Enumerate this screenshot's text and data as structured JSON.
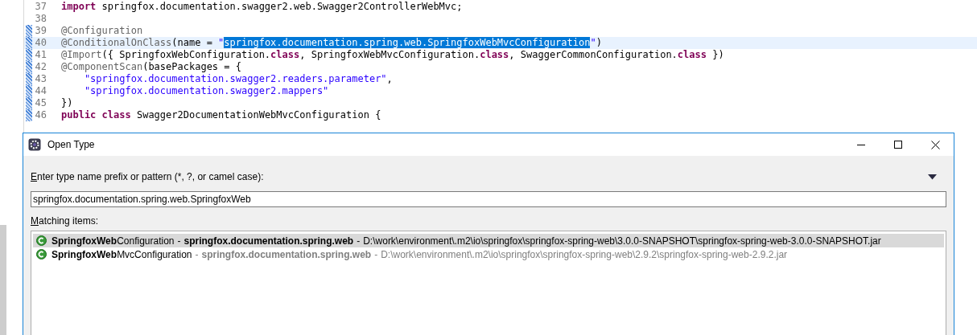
{
  "editor": {
    "lines": [
      {
        "number": "37",
        "current": false,
        "changed": false,
        "tokens": [
          {
            "kind": "keyword",
            "text": "import"
          },
          {
            "kind": "plain",
            "text": " springfox.documentation.swagger2.web.Swagger2ControllerWebMvc;"
          }
        ]
      },
      {
        "number": "38",
        "current": false,
        "changed": false
      },
      {
        "number": "39",
        "current": false,
        "changed": true,
        "tokens": [
          {
            "kind": "annotation",
            "text": "@Configuration"
          }
        ]
      },
      {
        "number": "40",
        "current": true,
        "changed": true,
        "tokens": [
          {
            "kind": "annotation",
            "text": "@ConditionalOnClass"
          },
          {
            "kind": "plain",
            "text": "(name = "
          },
          {
            "kind": "string",
            "text": "\""
          },
          {
            "kind": "selection",
            "text": "springfox.documentation.spring.web.SpringfoxWebMvcConfiguration"
          },
          {
            "kind": "string",
            "text": "\""
          },
          {
            "kind": "plain",
            "text": ")"
          }
        ]
      },
      {
        "number": "41",
        "current": false,
        "changed": true,
        "tokens": [
          {
            "kind": "annotation",
            "text": "@Import"
          },
          {
            "kind": "plain",
            "text": "({ SpringfoxWebConfiguration."
          },
          {
            "kind": "keyword",
            "text": "class"
          },
          {
            "kind": "plain",
            "text": ", SpringfoxWebMvcConfiguration."
          },
          {
            "kind": "keyword",
            "text": "class"
          },
          {
            "kind": "plain",
            "text": ", SwaggerCommonConfiguration."
          },
          {
            "kind": "keyword",
            "text": "class"
          },
          {
            "kind": "plain",
            "text": " })"
          }
        ]
      },
      {
        "number": "42",
        "current": false,
        "changed": true,
        "tokens": [
          {
            "kind": "annotation",
            "text": "@ComponentScan"
          },
          {
            "kind": "plain",
            "text": "(basePackages = {"
          }
        ]
      },
      {
        "number": "43",
        "current": false,
        "changed": true,
        "tokens": [
          {
            "kind": "string",
            "text": "    \"springfox.documentation.swagger2.readers.parameter\""
          },
          {
            "kind": "plain",
            "text": ","
          }
        ]
      },
      {
        "number": "44",
        "current": false,
        "changed": true,
        "tokens": [
          {
            "kind": "string",
            "text": "    \"springfox.documentation.swagger2.mappers\""
          }
        ]
      },
      {
        "number": "45",
        "current": false,
        "changed": true,
        "tokens": [
          {
            "kind": "plain",
            "text": "})"
          }
        ]
      },
      {
        "number": "46",
        "current": false,
        "changed": true,
        "tokens": [
          {
            "kind": "keyword",
            "text": "public"
          },
          {
            "kind": "keyword",
            "text": " class"
          },
          {
            "kind": "plain",
            "text": " Swagger2DocumentationWebMvcConfiguration {"
          }
        ]
      }
    ]
  },
  "dialog": {
    "title": "Open Type",
    "pattern_label": "Enter type name prefix or pattern (*, ?, or camel case):",
    "pattern_value": "springfox.documentation.spring.web.SpringfoxWeb",
    "list_label": "Matching items:",
    "items": [
      {
        "name": "**SpringfoxWeb**Configuration",
        "separators": [
          "-",
          "-"
        ],
        "package": "springfox.documentation.spring.web",
        "location": "D:\\work\\environment\\.m2\\io\\springfox\\springfox-spring-web\\3.0.0-SNAPSHOT\\springfox-spring-web-3.0.0-SNAPSHOT.jar",
        "selected": true,
        "dimmed": false
      },
      {
        "name": "**SpringfoxWeb**MvcConfiguration",
        "separators": [
          "-",
          "-"
        ],
        "package": "springfox.documentation.spring.web",
        "location": "D:\\work\\environment\\.m2\\io\\springfox\\springfox-spring-web\\2.9.2\\springfox-spring-web-2.9.2.jar",
        "selected": false,
        "dimmed": true
      }
    ]
  }
}
